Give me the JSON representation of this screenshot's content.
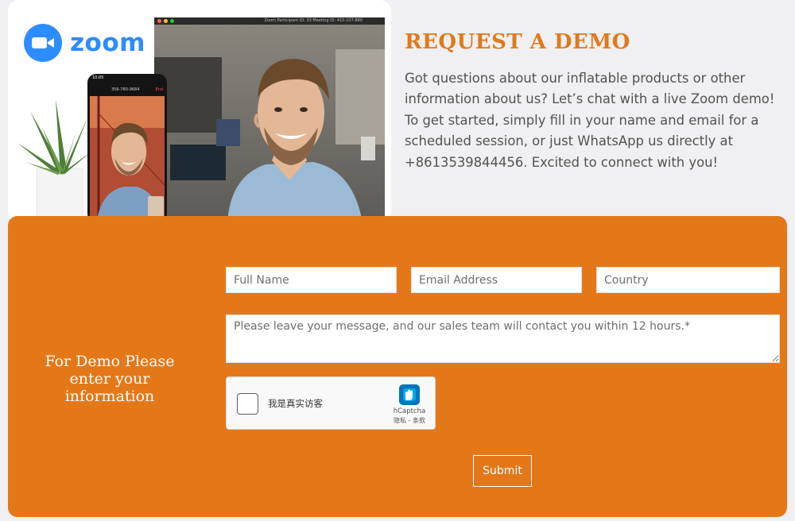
{
  "hero": {
    "logo_text": "zoom",
    "laptop_caption": "Zoom Participant ID: 33     Meeting ID: 415-107-880",
    "phone_time": "10:05",
    "phone_number": "356-780-9684",
    "phone_end": "End"
  },
  "intro": {
    "title": "REQUEST A DEMO",
    "description": "Got questions about our inflatable products or other information about us? Let’s chat with a live Zoom demo! To get started, simply fill in your name and email for a scheduled session, or just WhatsApp us directly at +8613539844456. Excited to connect with you!"
  },
  "form": {
    "heading": "For Demo Please enter your information",
    "full_name_placeholder": "Full Name",
    "email_placeholder": "Email Address",
    "country_placeholder": "Country",
    "message_placeholder": "Please leave your message, and our sales team will contact you within 12 hours.*",
    "captcha_label": "我是真实访客",
    "captcha_brand": "hCaptcha",
    "captcha_links": "隐私 - 条款",
    "submit_label": "Submit"
  },
  "colors": {
    "accent_orange": "#e47818",
    "title_orange": "#e07a1c",
    "zoom_blue": "#2d8cff",
    "page_bg": "#f0eff1"
  },
  "icons": {
    "zoom_logo": "video-camera-icon",
    "captcha_logo": "hcaptcha-hand-icon"
  }
}
